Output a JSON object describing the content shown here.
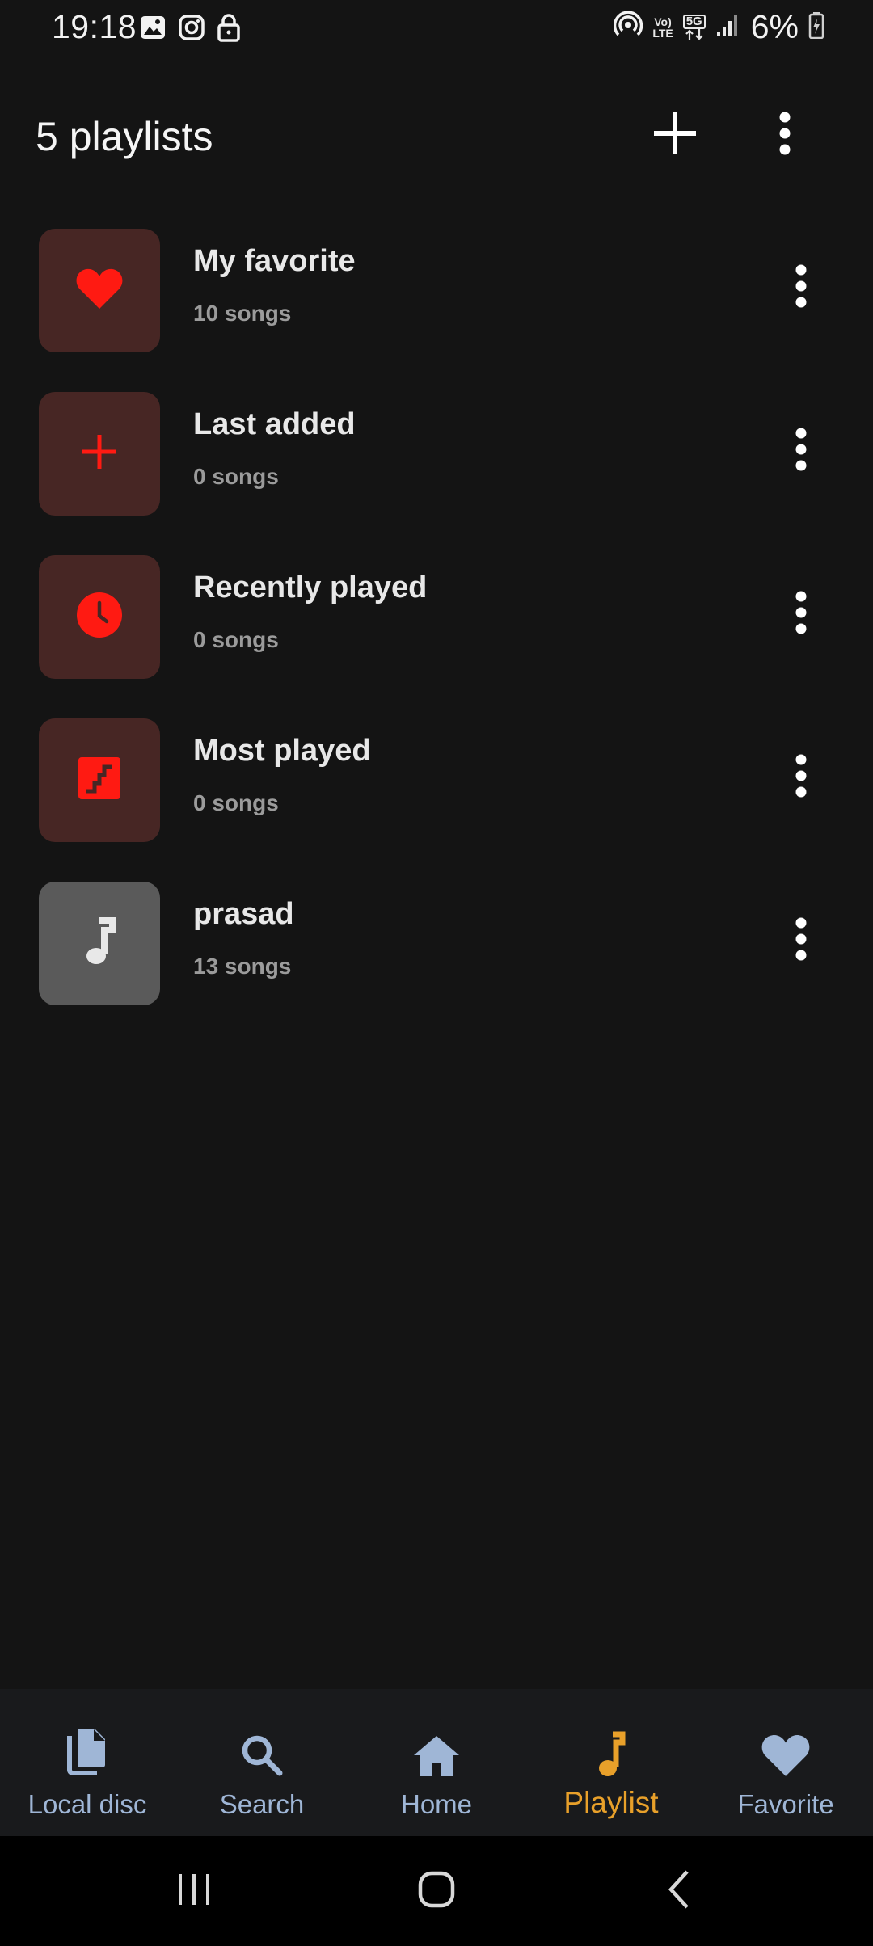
{
  "status_bar": {
    "time": "19:18",
    "battery": "6%",
    "volte_label_top": "Vo)",
    "volte_label_bottom": "LTE",
    "network_label": "5G",
    "icons": [
      "gallery-icon",
      "instagram-icon",
      "lock-icon",
      "hotspot-icon",
      "volte-icon",
      "5g-icon",
      "signal-icon",
      "battery-icon"
    ]
  },
  "header": {
    "title": "5 playlists",
    "add_icon": "plus-icon",
    "more_icon": "more-vertical-icon"
  },
  "playlists": [
    {
      "name": "My favorite",
      "count": "10 songs",
      "icon": "heart-icon",
      "tile": "#472624",
      "icon_color": "#ff1a12"
    },
    {
      "name": "Last added",
      "count": "0 songs",
      "icon": "plus-icon",
      "tile": "#472624",
      "icon_color": "#ff1a12"
    },
    {
      "name": "Recently played",
      "count": "0 songs",
      "icon": "clock-icon",
      "tile": "#472624",
      "icon_color": "#ff1a12"
    },
    {
      "name": "Most played",
      "count": "0 songs",
      "icon": "trending-icon",
      "tile": "#472624",
      "icon_color": "#ff1a12"
    },
    {
      "name": "prasad",
      "count": "13 songs",
      "icon": "music-note-icon",
      "tile": "#5a5a5a",
      "icon_color": "#e8e8e8"
    }
  ],
  "bottom_nav": {
    "items": [
      {
        "label": "Local disc",
        "icon": "file-copy-icon"
      },
      {
        "label": "Search",
        "icon": "search-icon"
      },
      {
        "label": "Home",
        "icon": "home-icon"
      },
      {
        "label": "Playlist",
        "icon": "music-note-icon",
        "active": true
      },
      {
        "label": "Favorite",
        "icon": "heart-icon"
      }
    ],
    "active_color": "#e8a02a",
    "inactive_color": "#9fb6d6"
  },
  "system_nav": {
    "buttons": [
      "recent-apps-icon",
      "home-circle-icon",
      "back-icon"
    ]
  }
}
